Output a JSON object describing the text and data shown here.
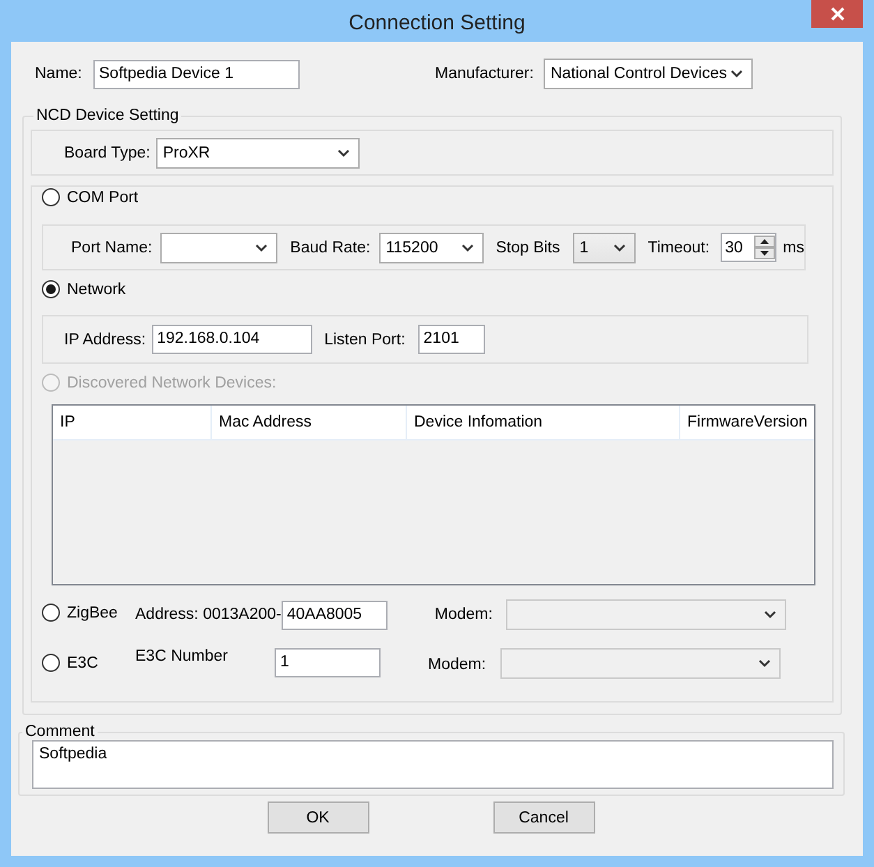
{
  "window": {
    "title": "Connection Setting"
  },
  "name_field": {
    "label": "Name:",
    "value": "Softpedia Device 1"
  },
  "manufacturer": {
    "label": "Manufacturer:",
    "value": "National Control Devices"
  },
  "device_setting": {
    "title": "NCD Device Setting"
  },
  "board_type": {
    "label": "Board Type:",
    "value": "ProXR"
  },
  "com_port": {
    "label": "COM Port",
    "selected": false,
    "port_name": {
      "label": "Port Name:"
    },
    "baud_rate": {
      "label": "Baud Rate:",
      "value": "115200"
    },
    "stop_bits": {
      "label": "Stop Bits",
      "value": "1"
    },
    "timeout": {
      "label": "Timeout:",
      "value": "30",
      "unit": "ms"
    }
  },
  "network": {
    "label": "Network",
    "selected": true,
    "ip_address": {
      "label": "IP Address:",
      "value": "192.168.0.104"
    },
    "listen_port": {
      "label": "Listen Port:",
      "value": "2101"
    }
  },
  "discovered": {
    "label": "Discovered Network Devices:",
    "selected": false,
    "disabled": true,
    "columns": [
      "IP",
      "Mac Address",
      "Device Infomation",
      "FirmwareVersion"
    ]
  },
  "zigbee": {
    "label": "ZigBee",
    "selected": false,
    "address_label": "Address: 0013A200-",
    "address_value": "40AA8005",
    "modem": {
      "label": "Modem:",
      "disabled": true
    }
  },
  "e3c": {
    "label": "E3C",
    "selected": false,
    "number_label": "E3C Number",
    "number_value": "1",
    "modem": {
      "label": "Modem:",
      "disabled": true
    }
  },
  "comment": {
    "label": "Comment",
    "value": "Softpedia"
  },
  "buttons": [
    "OK",
    "Cancel"
  ]
}
